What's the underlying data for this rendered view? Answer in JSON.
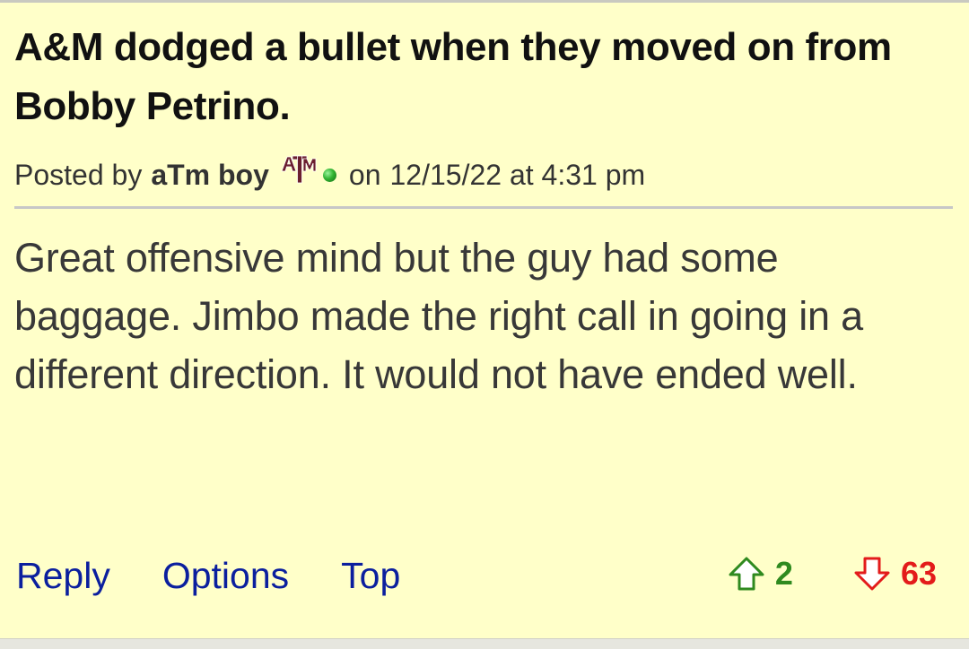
{
  "post": {
    "title": "A&M dodged a bullet when they moved on from Bobby Petrino.",
    "meta": {
      "posted_by_label": "Posted by",
      "author": "aTm boy",
      "team_logo_icon": "texas-am-logo-icon",
      "online_status_icon": "online-dot-icon",
      "on_label": "on",
      "datetime": "12/15/22 at 4:31 pm"
    },
    "body": "Great offensive mind but the guy had some baggage. Jimbo made the right call in going in a different direction. It would not have ended well."
  },
  "actions": {
    "reply_label": "Reply",
    "options_label": "Options",
    "top_label": "Top"
  },
  "votes": {
    "up_icon": "upvote-arrow-icon",
    "up_count": "2",
    "down_icon": "downvote-arrow-icon",
    "down_count": "63"
  },
  "colors": {
    "background": "#ffffc9",
    "link": "#0b1f9e",
    "upvote": "#2f8a1f",
    "downvote": "#e31b1b",
    "team_maroon": "#6b1f2e"
  }
}
